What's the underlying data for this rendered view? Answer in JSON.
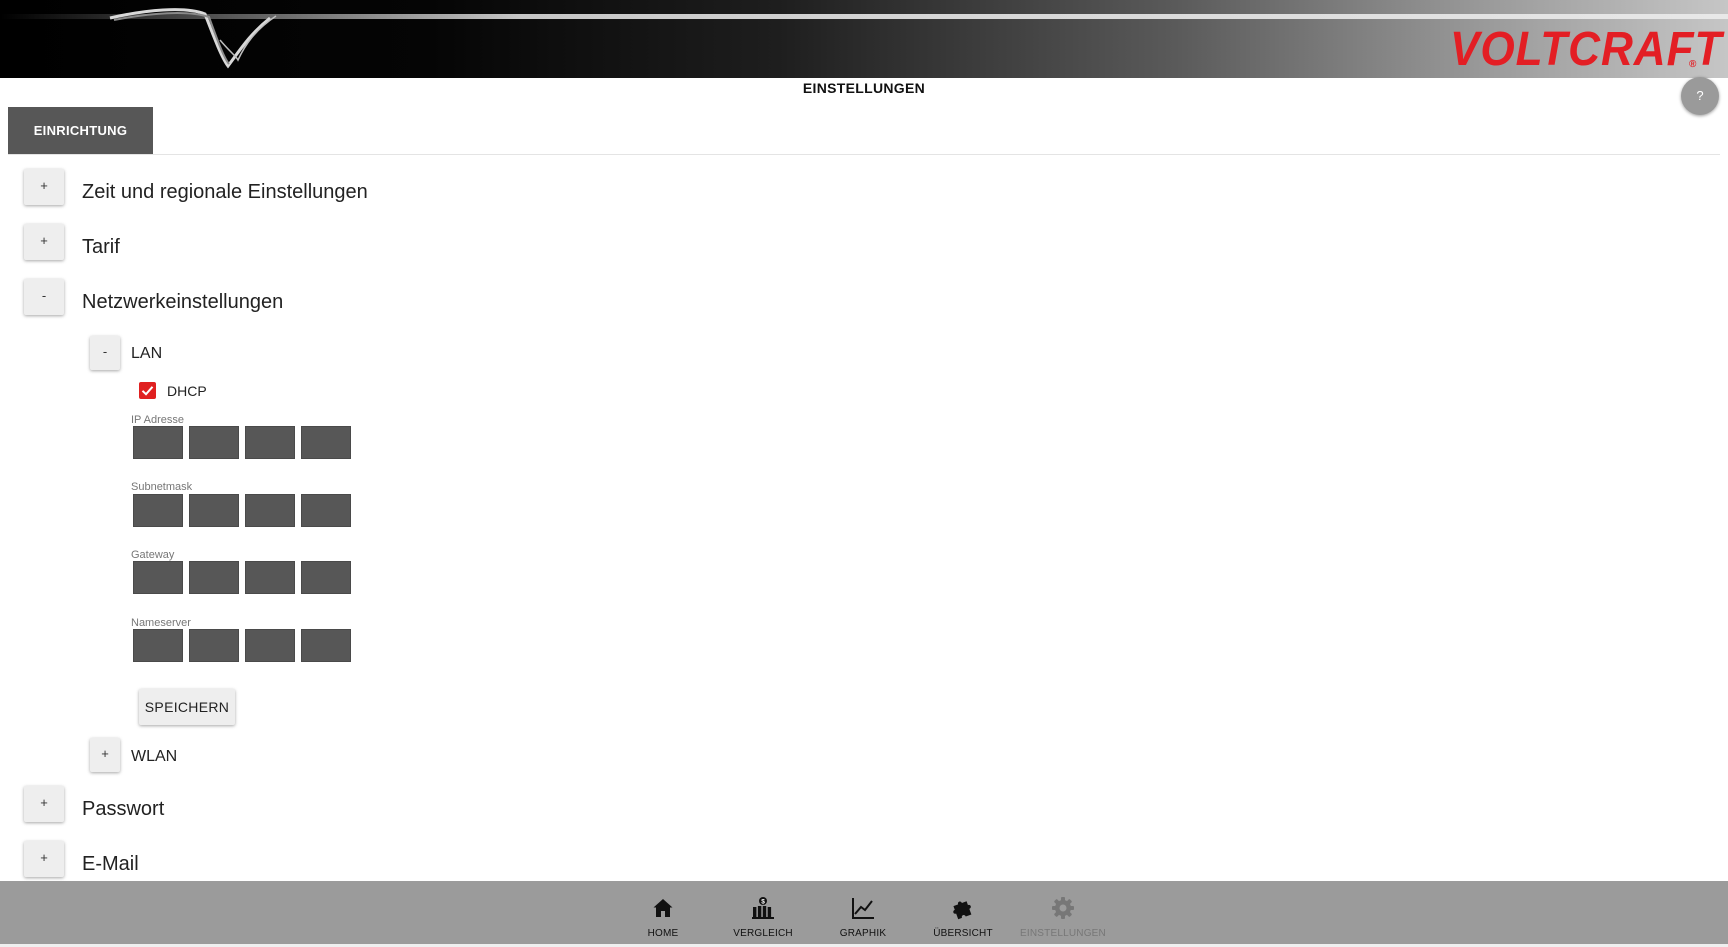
{
  "header": {
    "brand": "VOLTCRAFT",
    "brand_reg": "®",
    "brand_color": "#e31e24"
  },
  "page": {
    "title": "EINSTELLUNGEN",
    "help_label": "?"
  },
  "tabs": [
    {
      "label": "EINRICHTUNG",
      "active": true
    }
  ],
  "sections": {
    "zeit": {
      "toggle": "+",
      "label": "Zeit und regionale Einstellungen"
    },
    "tarif": {
      "toggle": "+",
      "label": "Tarif"
    },
    "netzwerk": {
      "toggle": "-",
      "label": "Netzwerkeinstellungen",
      "lan": {
        "toggle": "-",
        "label": "LAN",
        "dhcp_label": "DHCP",
        "dhcp_checked": true,
        "fields": {
          "ip": {
            "label": "IP Adresse"
          },
          "subnet": {
            "label": "Subnetmask"
          },
          "gateway": {
            "label": "Gateway"
          },
          "nameserver": {
            "label": "Nameserver"
          }
        },
        "save_label": "SPEICHERN"
      },
      "wlan": {
        "toggle": "+",
        "label": "WLAN"
      }
    },
    "passwort": {
      "toggle": "+",
      "label": "Passwort"
    },
    "email": {
      "toggle": "+",
      "label": "E-Mail"
    }
  },
  "bottom_nav": [
    {
      "label": "HOME",
      "icon": "home-icon"
    },
    {
      "label": "VERGLEICH",
      "icon": "comparison-icon"
    },
    {
      "label": "GRAPHIK",
      "icon": "chart-icon"
    },
    {
      "label": "ÜBERSICHT",
      "icon": "puzzle-icon"
    },
    {
      "label": "EINSTELLUNGEN",
      "icon": "gear-icon",
      "disabled": true
    }
  ],
  "colors": {
    "dark_field": "#575757",
    "checkbox": "#e02020",
    "nav_bg": "#9b9b9b"
  }
}
